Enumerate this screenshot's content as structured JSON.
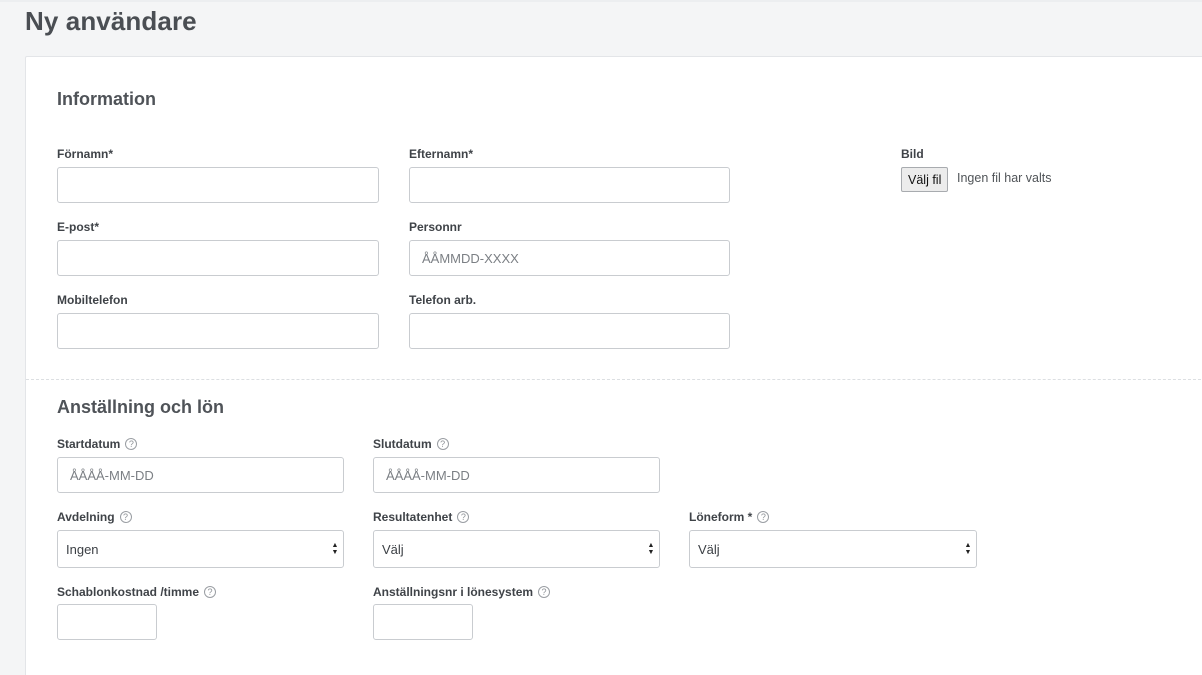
{
  "page": {
    "title": "Ny användare"
  },
  "information": {
    "title": "Information",
    "fields": {
      "firstname": {
        "label": "Förnamn*",
        "value": "",
        "placeholder": ""
      },
      "lastname": {
        "label": "Efternamn*",
        "value": "",
        "placeholder": ""
      },
      "email": {
        "label": "E-post*",
        "value": "",
        "placeholder": ""
      },
      "personnr": {
        "label": "Personnr",
        "value": "",
        "placeholder": "ÅÅMMDD-XXXX"
      },
      "mobile": {
        "label": "Mobiltelefon",
        "value": "",
        "placeholder": ""
      },
      "workphone": {
        "label": "Telefon arb.",
        "value": "",
        "placeholder": ""
      }
    },
    "picture": {
      "label": "Bild",
      "button": "Välj fil",
      "status": "Ingen fil har valts"
    }
  },
  "employment": {
    "title": "Anställning och lön",
    "fields": {
      "startdate": {
        "label": "Startdatum",
        "value": "",
        "placeholder": "ÅÅÅÅ-MM-DD"
      },
      "enddate": {
        "label": "Slutdatum",
        "value": "",
        "placeholder": "ÅÅÅÅ-MM-DD"
      },
      "department": {
        "label": "Avdelning",
        "value": "Ingen"
      },
      "resultunit": {
        "label": "Resultatenhet",
        "value": "Välj"
      },
      "salaryform": {
        "label": "Löneform *",
        "value": "Välj"
      },
      "standardcost": {
        "label": "Schablonkostnad /timme",
        "value": ""
      },
      "employeenr": {
        "label": "Anställningsnr i lönesystem",
        "value": ""
      }
    },
    "help_glyph": "?"
  },
  "colors": {
    "background": "#f4f5f6",
    "card": "#ffffff",
    "border": "#c9ccd0",
    "text": "#3b3f44"
  }
}
